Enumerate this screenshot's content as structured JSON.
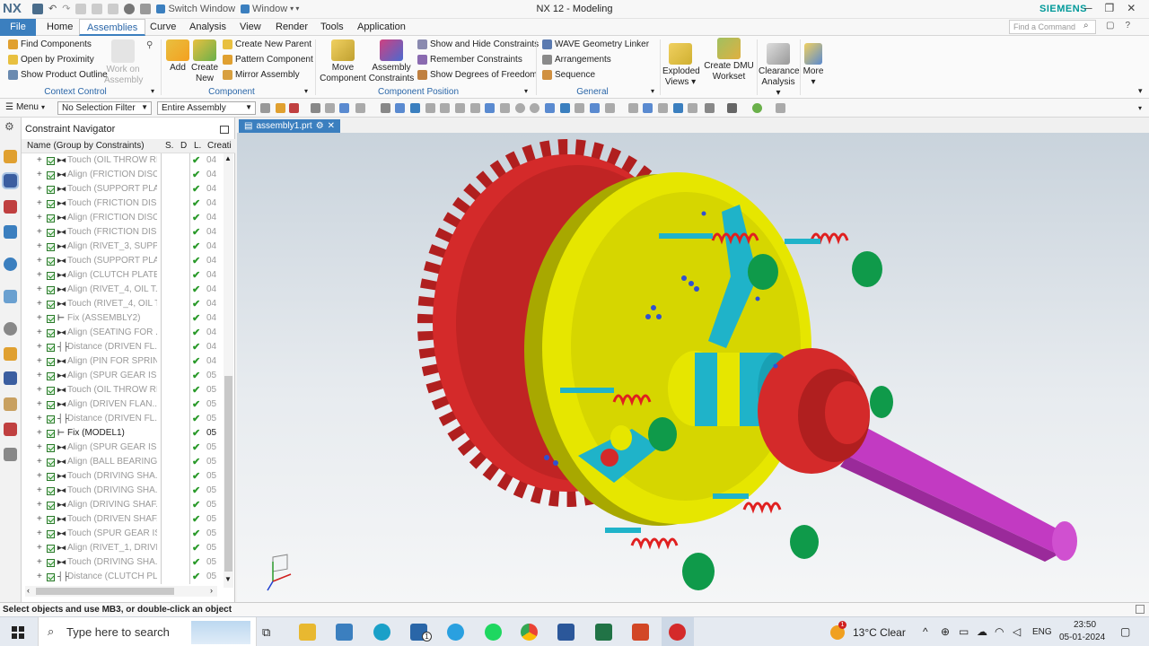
{
  "app": {
    "logo": "NX",
    "title": "NX 12 - Modeling",
    "brand": "SIEMENS",
    "switch_window": "Switch Window",
    "window_menu": "Window",
    "command_search_placeholder": "Find a Command"
  },
  "menu": {
    "tabs": [
      "File",
      "Home",
      "Assemblies",
      "Curve",
      "Analysis",
      "View",
      "Render",
      "Tools",
      "Application"
    ],
    "active": "Assemblies"
  },
  "ribbon": {
    "context_control": {
      "find_components": "Find Components",
      "open_by_proximity": "Open by Proximity",
      "show_product_outline": "Show Product Outline",
      "work_on_assembly": "Work on Assembly",
      "group_label": "Context Control"
    },
    "component": {
      "add": "Add",
      "create_new": "Create New",
      "create_new_parent": "Create New Parent",
      "pattern_component": "Pattern Component",
      "mirror_assembly": "Mirror Assembly",
      "group_label": "Component"
    },
    "component_position": {
      "move_component": "Move Component",
      "assembly_constraints": "Assembly Constraints",
      "show_hide_constraints": "Show and Hide Constraints",
      "remember_constraints": "Remember Constraints",
      "show_dof": "Show Degrees of Freedom",
      "group_label": "Component Position"
    },
    "general": {
      "wave_linker": "WAVE Geometry Linker",
      "arrangements": "Arrangements",
      "sequence": "Sequence",
      "group_label": "General"
    },
    "exploded_views": "Exploded Views",
    "create_dmu_workset": "Create DMU Workset",
    "clearance_analysis": "Clearance Analysis",
    "more": "More"
  },
  "toolbar": {
    "menu": "Menu",
    "selection_filter": "No Selection Filter",
    "scope": "Entire Assembly"
  },
  "navigator": {
    "title": "Constraint Navigator",
    "columns": [
      "Name (Group by Constraints)",
      "S.",
      "D",
      "L.",
      "Creati"
    ],
    "rows": [
      {
        "name": "Touch (OIL THROW RI...",
        "created": "04",
        "type": "touch",
        "active": false
      },
      {
        "name": "Align (FRICTION DISC...",
        "created": "04",
        "type": "align",
        "active": false
      },
      {
        "name": "Touch (SUPPORT PLA...",
        "created": "04",
        "type": "touch",
        "active": false
      },
      {
        "name": "Touch (FRICTION DIS...",
        "created": "04",
        "type": "touch",
        "active": false
      },
      {
        "name": "Align (FRICTION DISC...",
        "created": "04",
        "type": "align",
        "active": false
      },
      {
        "name": "Touch (FRICTION DIS...",
        "created": "04",
        "type": "touch",
        "active": false
      },
      {
        "name": "Align (RIVET_3, SUPP...",
        "created": "04",
        "type": "align",
        "active": false
      },
      {
        "name": "Touch (SUPPORT PLA...",
        "created": "04",
        "type": "touch",
        "active": false
      },
      {
        "name": "Align (CLUTCH PLATE...",
        "created": "04",
        "type": "align",
        "active": false
      },
      {
        "name": "Align (RIVET_4, OIL T...",
        "created": "04",
        "type": "align",
        "active": false
      },
      {
        "name": "Touch (RIVET_4, OIL T...",
        "created": "04",
        "type": "touch",
        "active": false
      },
      {
        "name": "Fix (ASSEMBLY2)",
        "created": "04",
        "type": "fix",
        "active": false
      },
      {
        "name": "Align (SEATING FOR ...",
        "created": "04",
        "type": "align",
        "active": false
      },
      {
        "name": "Distance (DRIVEN FL...",
        "created": "04",
        "type": "distance",
        "active": false
      },
      {
        "name": "Align (PIN FOR SPRIN...",
        "created": "04",
        "type": "align",
        "active": false
      },
      {
        "name": "Align (SPUR GEAR IS...",
        "created": "05",
        "type": "align",
        "active": false
      },
      {
        "name": "Touch (OIL THROW RI...",
        "created": "05",
        "type": "touch",
        "active": false
      },
      {
        "name": "Align (DRIVEN FLAN...",
        "created": "05",
        "type": "align",
        "active": false
      },
      {
        "name": "Distance (DRIVEN FL...",
        "created": "05",
        "type": "distance",
        "active": false
      },
      {
        "name": "Fix (MODEL1)",
        "created": "05",
        "type": "fix",
        "active": true
      },
      {
        "name": "Align (SPUR GEAR IS...",
        "created": "05",
        "type": "align",
        "active": false
      },
      {
        "name": "Align (BALL BEARING...",
        "created": "05",
        "type": "align",
        "active": false
      },
      {
        "name": "Touch (DRIVING SHA...",
        "created": "05",
        "type": "touch",
        "active": false
      },
      {
        "name": "Touch (DRIVING SHA...",
        "created": "05",
        "type": "touch",
        "active": false
      },
      {
        "name": "Align (DRIVING SHAF...",
        "created": "05",
        "type": "align",
        "active": false
      },
      {
        "name": "Touch (DRIVEN SHAF...",
        "created": "05",
        "type": "touch",
        "active": false
      },
      {
        "name": "Touch (SPUR GEAR IS...",
        "created": "05",
        "type": "touch",
        "active": false
      },
      {
        "name": "Align (RIVET_1, DRIVI...",
        "created": "05",
        "type": "align",
        "active": false
      },
      {
        "name": "Touch (DRIVING SHA...",
        "created": "05",
        "type": "touch",
        "active": false
      },
      {
        "name": "Distance (CLUTCH PL...",
        "created": "05",
        "type": "distance",
        "active": false
      }
    ]
  },
  "graphics": {
    "doc_tab": "assembly1.prt"
  },
  "status": {
    "message": "Select objects and use MB3, or double-click an object"
  },
  "taskbar": {
    "search_placeholder": "Type here to search",
    "weather": "13°C  Clear",
    "weather_badge": "1",
    "mail_badge": "1",
    "language": "ENG",
    "time": "23:50",
    "date": "05-01-2024"
  },
  "colors": {
    "accent": "#3b7fbf",
    "brand": "#009999",
    "gear_red": "#d42a2a",
    "plate_yellow": "#e6e600",
    "shaft_magenta": "#c23ac2",
    "hub_cyan": "#1fb3c9",
    "ring_green": "#0f9a4a"
  }
}
